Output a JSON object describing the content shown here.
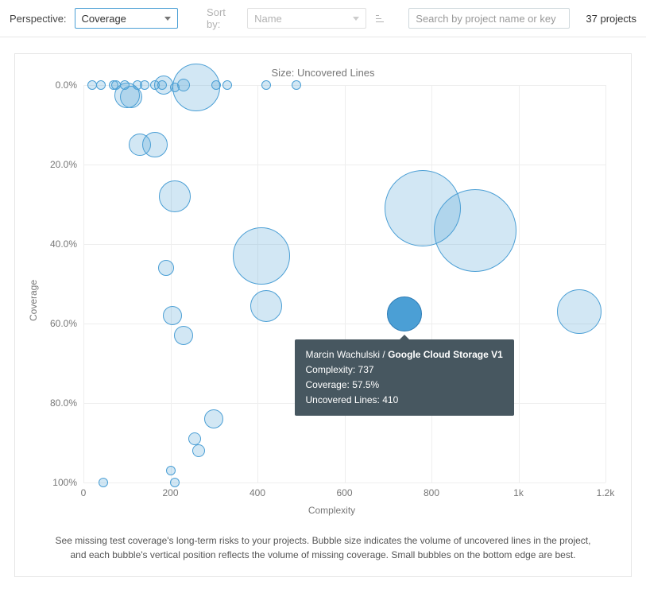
{
  "toolbar": {
    "perspective_label": "Perspective:",
    "perspective_value": "Coverage",
    "sort_label": "Sort by:",
    "sort_value": "Name",
    "search_placeholder": "Search by project name or key",
    "project_count": "37 projects"
  },
  "chart_data": {
    "type": "scatter",
    "title": "Size: Uncovered Lines",
    "xlabel": "Complexity",
    "ylabel": "Coverage",
    "x_ticks": [
      0,
      200,
      400,
      600,
      800,
      "1k",
      "1.2k"
    ],
    "y_ticks": [
      "0.0%",
      "20.0%",
      "40.0%",
      "60.0%",
      "80.0%",
      "100%"
    ],
    "x_range": [
      0,
      1200
    ],
    "y_range": [
      0,
      100
    ],
    "points": [
      {
        "x": 20,
        "y": 0.0,
        "r": 6
      },
      {
        "x": 40,
        "y": 0.0,
        "r": 6
      },
      {
        "x": 70,
        "y": 0.0,
        "r": 6
      },
      {
        "x": 75,
        "y": 0.0,
        "r": 6
      },
      {
        "x": 95,
        "y": 0.0,
        "r": 6
      },
      {
        "x": 100,
        "y": 2.5,
        "r": 16
      },
      {
        "x": 110,
        "y": 3.0,
        "r": 14
      },
      {
        "x": 125,
        "y": 0.0,
        "r": 6
      },
      {
        "x": 140,
        "y": 0.0,
        "r": 6
      },
      {
        "x": 165,
        "y": 0.0,
        "r": 6
      },
      {
        "x": 180,
        "y": 0.0,
        "r": 6
      },
      {
        "x": 185,
        "y": 0.0,
        "r": 12
      },
      {
        "x": 210,
        "y": 0.5,
        "r": 6
      },
      {
        "x": 230,
        "y": 0.0,
        "r": 8
      },
      {
        "x": 260,
        "y": 0.5,
        "r": 30
      },
      {
        "x": 305,
        "y": 0.0,
        "r": 6
      },
      {
        "x": 330,
        "y": 0.0,
        "r": 6
      },
      {
        "x": 420,
        "y": 0.0,
        "r": 6
      },
      {
        "x": 490,
        "y": 0.0,
        "r": 6
      },
      {
        "x": 130,
        "y": 15.0,
        "r": 14
      },
      {
        "x": 165,
        "y": 15.0,
        "r": 16
      },
      {
        "x": 210,
        "y": 28.0,
        "r": 20
      },
      {
        "x": 190,
        "y": 46.0,
        "r": 10
      },
      {
        "x": 205,
        "y": 58.0,
        "r": 12
      },
      {
        "x": 230,
        "y": 63.0,
        "r": 12
      },
      {
        "x": 300,
        "y": 84.0,
        "r": 12
      },
      {
        "x": 255,
        "y": 89.0,
        "r": 8
      },
      {
        "x": 265,
        "y": 92.0,
        "r": 8
      },
      {
        "x": 200,
        "y": 97.0,
        "r": 6
      },
      {
        "x": 210,
        "y": 100.0,
        "r": 6
      },
      {
        "x": 45,
        "y": 100.0,
        "r": 6
      },
      {
        "x": 410,
        "y": 43.0,
        "r": 36
      },
      {
        "x": 420,
        "y": 55.5,
        "r": 20
      },
      {
        "x": 780,
        "y": 31.0,
        "r": 48
      },
      {
        "x": 900,
        "y": 36.5,
        "r": 52
      },
      {
        "x": 1140,
        "y": 57.0,
        "r": 28
      },
      {
        "x": 737,
        "y": 57.5,
        "r": 22,
        "hover": true,
        "tooltip": {
          "owner": "Marcin Wachulski / ",
          "repo": "Google Cloud Storage V1",
          "complexity_label": "Complexity:",
          "complexity_value": "737",
          "coverage_label": "Coverage:",
          "coverage_value": "57.5%",
          "uncov_label": "Uncovered Lines:",
          "uncov_value": "410"
        }
      }
    ]
  },
  "caption": {
    "line1": "See missing test coverage's long-term risks to your projects. Bubble size indicates the volume of uncovered lines in the project,",
    "line2": "and each bubble's vertical position reflects the volume of missing coverage. Small bubbles on the bottom edge are best."
  }
}
